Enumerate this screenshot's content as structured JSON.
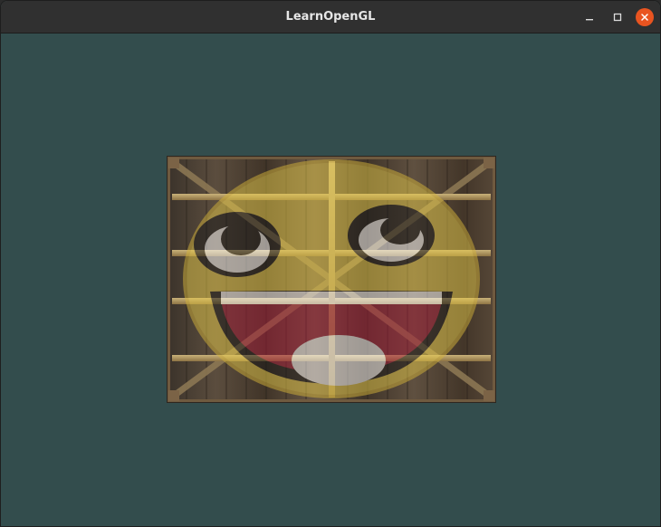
{
  "window": {
    "title": "LearnOpenGL"
  },
  "controls": {
    "minimize_icon": "minimize-icon",
    "maximize_icon": "maximize-icon",
    "close_icon": "close-icon"
  },
  "colors": {
    "clear_color": "#334d4d",
    "titlebar": "#303030",
    "close_button": "#e95420"
  },
  "textures": {
    "base": "wooden-container",
    "overlay": "awesome-face",
    "mix_opacity": 0.5
  }
}
